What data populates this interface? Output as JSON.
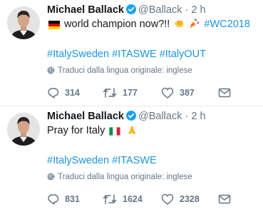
{
  "tweets": [
    {
      "author_name": "Michael Ballack",
      "handle": "@Ballack",
      "separator": "·",
      "time": "2 h",
      "text_main": "world champion now?!!",
      "inline_hashtag": "#WC2018",
      "hashtags": [
        "#ItalySweden",
        "#ITASWE",
        "#ItalyOUT"
      ],
      "translate_label": "Traduci dalla lingua originale: inglese",
      "replies": "314",
      "retweets": "177",
      "likes": "387",
      "emojis": [
        "german-flag",
        "fist-bump",
        "party-popper"
      ]
    },
    {
      "author_name": "Michael Ballack",
      "handle": "@Ballack",
      "separator": "·",
      "time": "2 h",
      "text_main": "Pray for Italy",
      "hashtags": [
        "#ItalySweden",
        "#ITASWE"
      ],
      "translate_label": "Traduci dalla lingua originale: inglese",
      "replies": "831",
      "retweets": "1624",
      "likes": "2328",
      "emojis": [
        "italian-flag",
        "folded-hands"
      ]
    }
  ],
  "colors": {
    "text": "#14171a",
    "muted": "#657786",
    "link": "#1b95e0",
    "verified": "#1da1f2",
    "divider": "#e6ecf0"
  }
}
